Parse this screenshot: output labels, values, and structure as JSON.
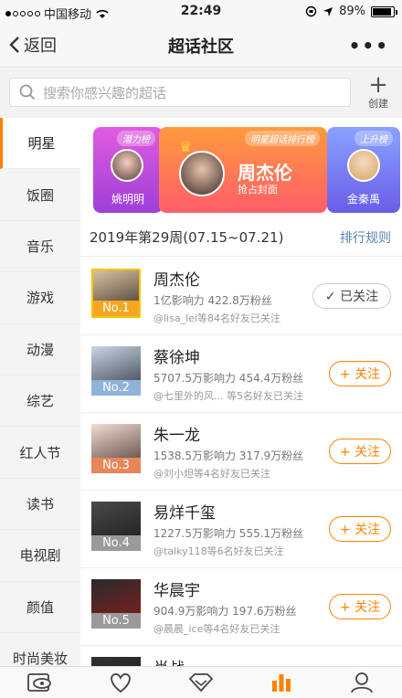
{
  "status_bar": {
    "carrier": "中国移动",
    "time": "22:49",
    "battery": "89%",
    "battery_level": 0.89
  },
  "nav": {
    "back_label": "返回",
    "title": "超话社区",
    "more": "•••"
  },
  "search": {
    "placeholder": "搜索你感兴趣的超话",
    "create_label": "创建"
  },
  "sidebar": {
    "items": [
      {
        "label": "明星"
      },
      {
        "label": "饭圈"
      },
      {
        "label": "音乐"
      },
      {
        "label": "游戏"
      },
      {
        "label": "动漫"
      },
      {
        "label": "综艺"
      },
      {
        "label": "红人节"
      },
      {
        "label": "读书"
      },
      {
        "label": "电视剧"
      },
      {
        "label": "颜值"
      },
      {
        "label": "时尚美妆"
      }
    ]
  },
  "banner": {
    "left": {
      "tag": "潜力榜",
      "name": "姚明明"
    },
    "center": {
      "tag": "明星超话排行榜",
      "name": "周杰伦",
      "sub": "抢占封面"
    },
    "right": {
      "tag": "上升榜",
      "name": "金秦禹"
    }
  },
  "week": {
    "label": "2019年第29周(07.15~07.21)",
    "rule": "排行规则"
  },
  "ranking": [
    {
      "name": "周杰伦",
      "stat": "1亿影响力 422.8万粉丝",
      "friends": "@lisa_lei等84名好友已关注",
      "rank": "No.1",
      "button": "✓ 已关注",
      "followed": true,
      "rank_color": "#f5a623"
    },
    {
      "name": "蔡徐坤",
      "stat": "5707.5万影响力 454.4万粉丝",
      "friends": "@七里外的风...  等5名好友已关注",
      "rank": "No.2",
      "button": "+ 关注",
      "followed": false,
      "rank_color": "#8fb2d9"
    },
    {
      "name": "朱一龙",
      "stat": "1538.5万影响力 317.9万粉丝",
      "friends": "@刘小炟等4名好友已关注",
      "rank": "No.3",
      "button": "+ 关注",
      "followed": false,
      "rank_color": "#e8865a"
    },
    {
      "name": "易烊千玺",
      "stat": "1227.5万影响力 555.1万粉丝",
      "friends": "@talky118等6名好友已关注",
      "rank": "No.4",
      "button": "+ 关注",
      "followed": false,
      "rank_color": "#9a9a9a"
    },
    {
      "name": "华晨宇",
      "stat": "904.9万影响力 197.6万粉丝",
      "friends": "@晨晨_ice等4名好友已关注",
      "rank": "No.5",
      "button": "+ 关注",
      "followed": false,
      "rank_color": "#9a9a9a"
    },
    {
      "name": "肖战",
      "stat": "",
      "friends": "",
      "rank": "",
      "button": "",
      "followed": false,
      "rank_color": "#9a9a9a"
    }
  ],
  "colors": {
    "accent": "#ff8200",
    "link": "#5b7fb0"
  },
  "tabbar": {
    "icons": [
      "eye-card-icon",
      "heart-icon",
      "diamond-icon",
      "chart-bar-icon",
      "person-icon"
    ],
    "active": 3
  }
}
